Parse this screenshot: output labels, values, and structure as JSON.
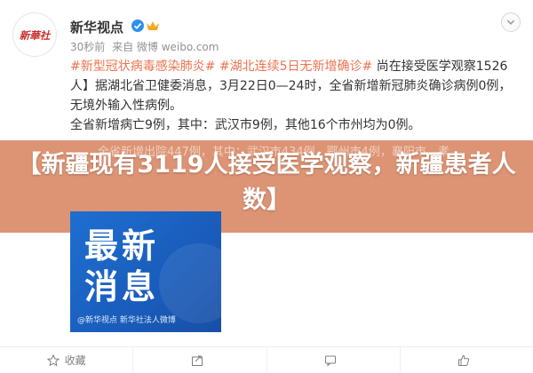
{
  "author": {
    "name": "新华视点",
    "avatar_text": "新華社"
  },
  "meta": {
    "time": "30秒前",
    "source": "来自 微博 weibo.com"
  },
  "post": {
    "tag1": "#新型冠状病毒感染肺炎#",
    "tag2": "#湖北连续5日无新增确诊#",
    "line1_tail": " 尚在接受医学观察1526人】据湖北省卫健委消息，3月22日0—24时，全省新增新冠肺炎确诊病例0例，无境外输入性病例。",
    "line2": "全省新增病亡9例，其中：武汉市9例，其他16个市州均为0例。",
    "line3_partial": "全省新增出院447例，其中：武汉市434例，鄂州市4例，襄阳市、孝"
  },
  "headline": "【新疆现有3119人接受医学观察，新疆患者人数】",
  "image": {
    "title_line1": "最新",
    "title_line2": "消息",
    "caption": "@新华视点 新华社法人微博"
  },
  "actions": {
    "favorite": "收藏",
    "share": "",
    "comment": "",
    "like": ""
  },
  "colors": {
    "tag": "#eb7350",
    "overlay": "#d67c56",
    "image_bg": "#1e6fd0"
  }
}
